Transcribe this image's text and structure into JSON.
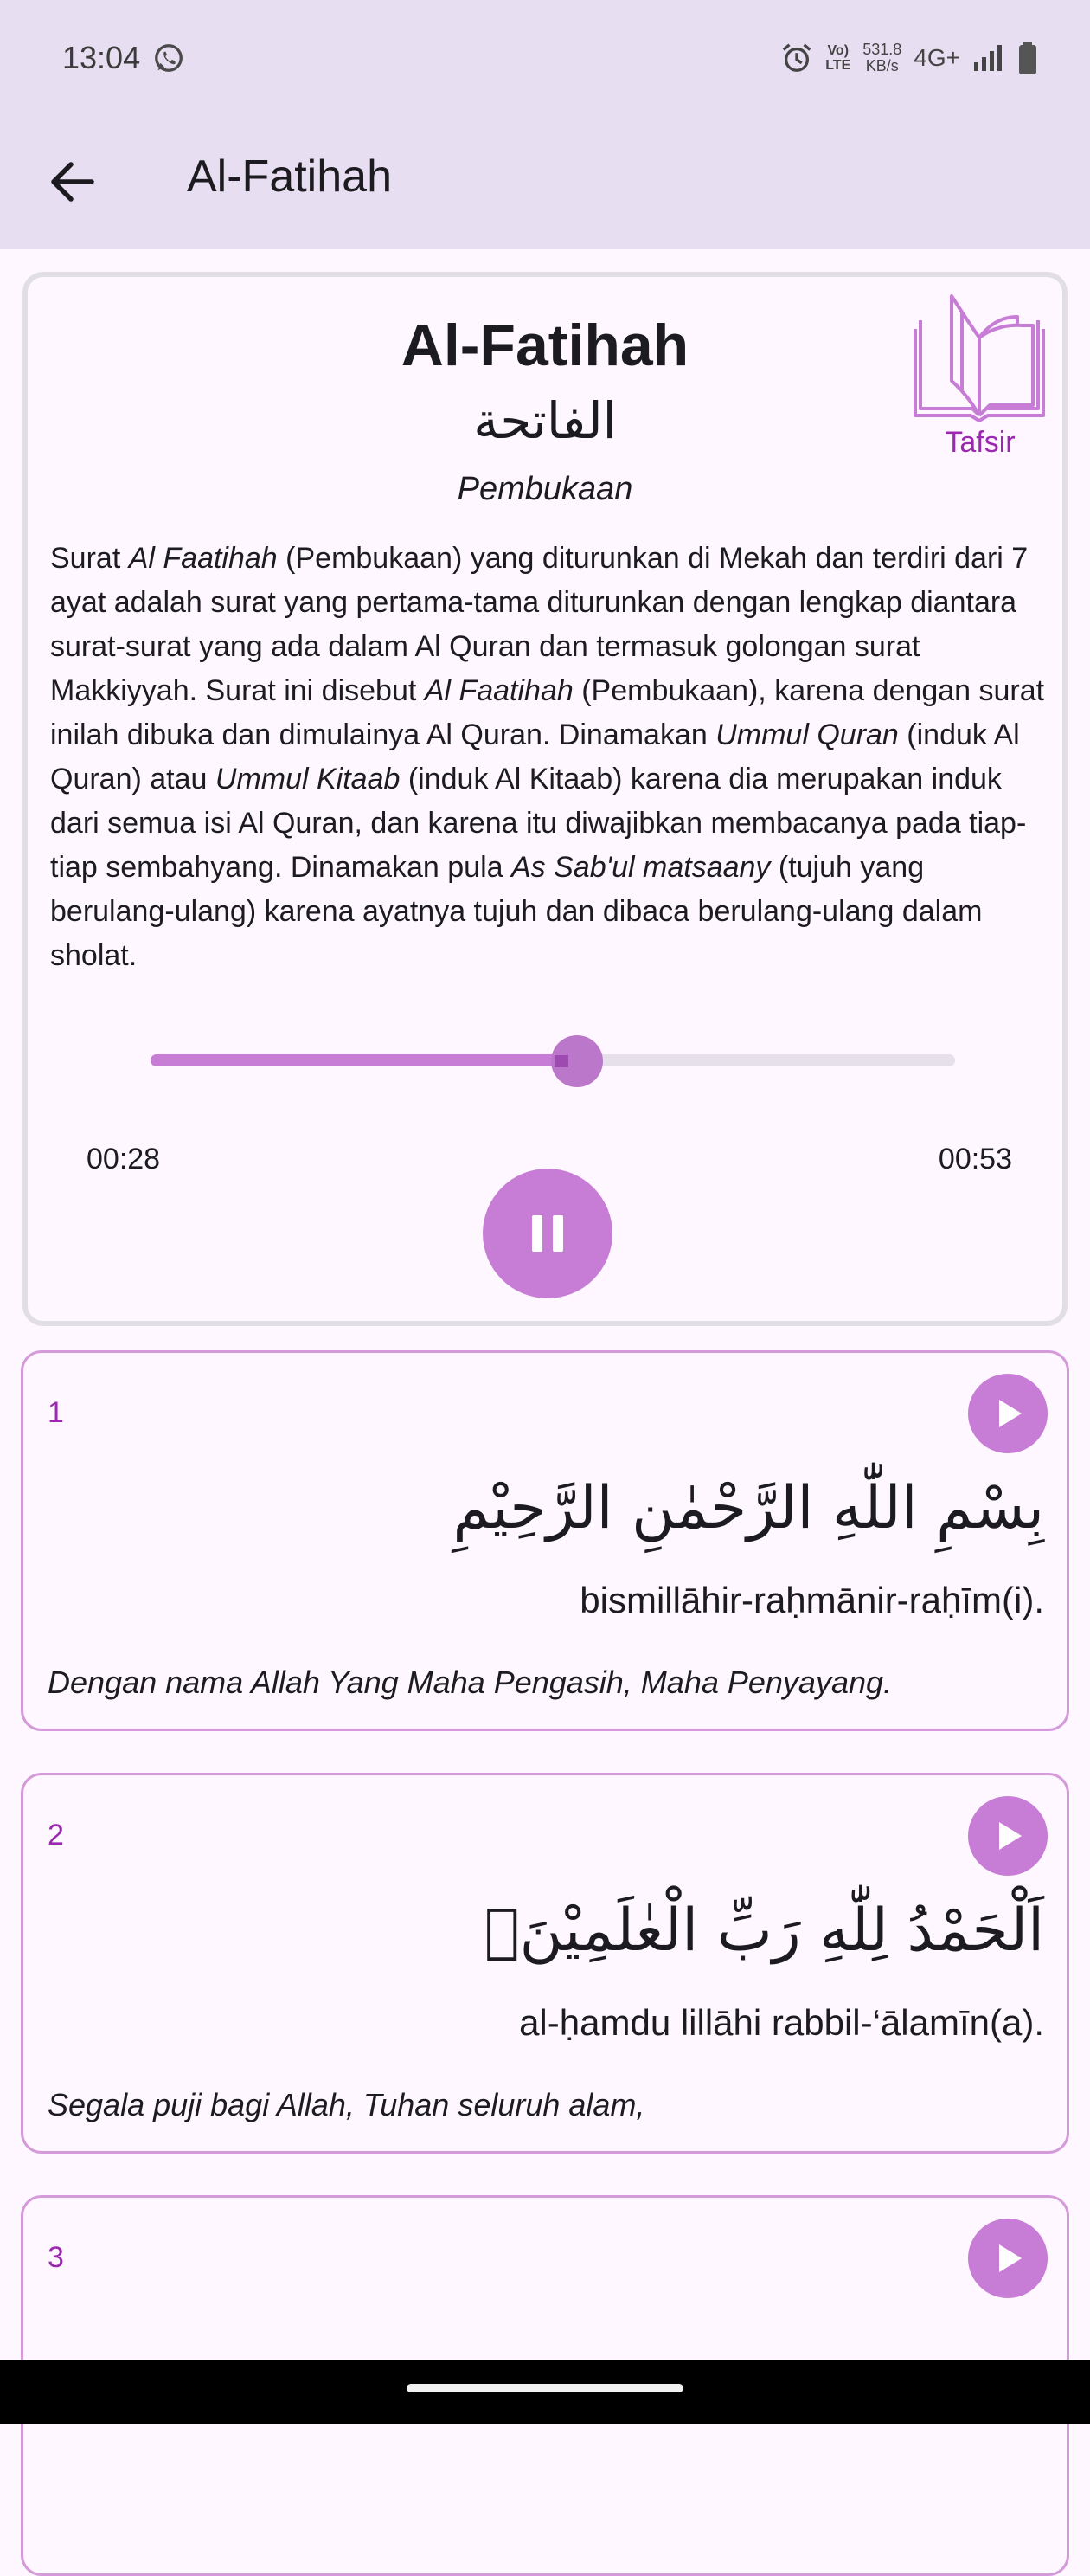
{
  "status_bar": {
    "time": "13:04",
    "volte_top": "Vo)",
    "volte_bottom": "LTE",
    "speed_value": "531.8",
    "speed_unit": "KB/s",
    "network": "4G+"
  },
  "toolbar": {
    "title": "Al-Fatihah"
  },
  "header": {
    "name_latin": "Al-Fatihah",
    "name_arabic": "الفاتحة",
    "meaning": "Pembukaan",
    "tafsir_label": "Tafsir",
    "description_parts": [
      "Surat ",
      "Al Faatihah",
      " (Pembukaan) yang diturunkan di Mekah dan terdiri dari 7 ayat adalah surat yang pertama-tama diturunkan dengan lengkap diantara surat-surat yang ada dalam Al Quran dan termasuk golongan surat Makkiyyah. Surat ini disebut ",
      "Al Faatihah",
      " (Pembukaan), karena dengan surat inilah dibuka dan dimulainya Al Quran. Dinamakan ",
      "Ummul Quran",
      " (induk Al Quran) atau ",
      "Ummul Kitaab",
      " (induk Al Kitaab) karena dia merupakan induk dari semua isi Al Quran, dan karena itu diwajibkan membacanya pada tiap-tiap sembahyang. Dinamakan pula ",
      "As Sab'ul matsaany",
      " (tujuh yang berulang-ulang) karena ayatnya tujuh dan dibaca berulang-ulang dalam sholat."
    ]
  },
  "player": {
    "current_time": "00:28",
    "total_time": "00:53",
    "progress": 0.53,
    "state": "playing"
  },
  "ayahs": [
    {
      "number": "1",
      "arabic": "بِسْمِ اللّٰهِ الرَّحْمٰنِ الرَّحِيْمِ",
      "latin": "bismillāhir-raḥmānir-raḥīm(i).",
      "translation": "Dengan nama Allah Yang Maha Pengasih, Maha Penyayang."
    },
    {
      "number": "2",
      "arabic": "اَلْحَمْدُ لِلّٰهِ رَبِّ الْعٰلَمِيْنَۙ",
      "latin": "al-ḥamdu lillāhi rabbil-‘ālamīn(a).",
      "translation": "Segala puji bagi Allah, Tuhan seluruh alam,"
    },
    {
      "number": "3",
      "arabic": "",
      "latin": "",
      "translation": ""
    }
  ],
  "colors": {
    "app_bar": "#e8def1",
    "accent": "#9c27b0",
    "accent_light": "#c77dd5",
    "card_border": "#d49ad9"
  }
}
